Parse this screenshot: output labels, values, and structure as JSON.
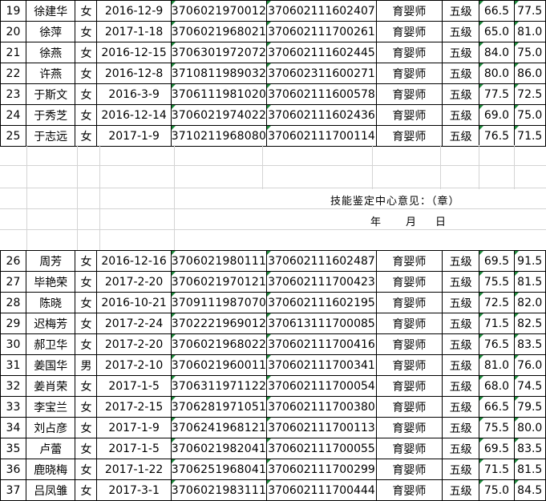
{
  "upper_rows": [
    {
      "idx": "19",
      "name": "徐建华",
      "sex": "女",
      "date": "2016-12-9",
      "cert": "3706021970012",
      "cid": "370602111602407",
      "job": "育婴师",
      "level": "五级",
      "s1": "66.5",
      "s2": "77.5"
    },
    {
      "idx": "20",
      "name": "徐萍",
      "sex": "女",
      "date": "2017-1-18",
      "cert": "3706021968021",
      "cid": "370602111700261",
      "job": "育婴师",
      "level": "五级",
      "s1": "65.0",
      "s2": "81.0"
    },
    {
      "idx": "21",
      "name": "徐燕",
      "sex": "女",
      "date": "2016-12-15",
      "cert": "3706301972072",
      "cid": "370602111602445",
      "job": "育婴师",
      "level": "五级",
      "s1": "84.0",
      "s2": "75.0"
    },
    {
      "idx": "22",
      "name": "许燕",
      "sex": "女",
      "date": "2016-12-8",
      "cert": "3710811989032",
      "cid": "370602311600271",
      "job": "育婴师",
      "level": "五级",
      "s1": "80.0",
      "s2": "86.0"
    },
    {
      "idx": "23",
      "name": "于斯文",
      "sex": "女",
      "date": "2016-3-9",
      "cert": "3706111981020",
      "cid": "370602111600578",
      "job": "育婴师",
      "level": "五级",
      "s1": "77.5",
      "s2": "72.5"
    },
    {
      "idx": "24",
      "name": "于秀芝",
      "sex": "女",
      "date": "2016-12-14",
      "cert": "3706021974022",
      "cid": "370602111602436",
      "job": "育婴师",
      "level": "五级",
      "s1": "69.0",
      "s2": "75.0"
    },
    {
      "idx": "25",
      "name": "于志远",
      "sex": "女",
      "date": "2017-1-9",
      "cert": "3710211968080",
      "cid": "370602111700114",
      "job": "育婴师",
      "level": "五级",
      "s1": "76.5",
      "s2": "71.5"
    }
  ],
  "opinion": {
    "label": "技能鉴定中心意见：（章）",
    "year": "年",
    "month": "月",
    "day": "日"
  },
  "lower_rows": [
    {
      "idx": "26",
      "name": "周芳",
      "sex": "女",
      "date": "2016-12-16",
      "cert": "3706021980111",
      "cid": "370602111602487",
      "job": "育婴师",
      "level": "五级",
      "s1": "69.5",
      "s2": "91.5"
    },
    {
      "idx": "27",
      "name": "毕艳荣",
      "sex": "女",
      "date": "2017-2-20",
      "cert": "3706021970121",
      "cid": "370602111700423",
      "job": "育婴师",
      "level": "五级",
      "s1": "75.5",
      "s2": "81.5"
    },
    {
      "idx": "28",
      "name": "陈晓",
      "sex": "女",
      "date": "2016-10-21",
      "cert": "3709111987070",
      "cid": "370602111602195",
      "job": "育婴师",
      "level": "五级",
      "s1": "72.5",
      "s2": "82.0"
    },
    {
      "idx": "29",
      "name": "迟梅芳",
      "sex": "女",
      "date": "2017-2-24",
      "cert": "3702221969012",
      "cid": "370613111700085",
      "job": "育婴师",
      "level": "五级",
      "s1": "71.5",
      "s2": "82.5"
    },
    {
      "idx": "30",
      "name": "郝卫华",
      "sex": "女",
      "date": "2017-2-20",
      "cert": "3706021968022",
      "cid": "370602111700416",
      "job": "育婴师",
      "level": "五级",
      "s1": "76.5",
      "s2": "83.5"
    },
    {
      "idx": "31",
      "name": "姜国华",
      "sex": "男",
      "date": "2017-2-10",
      "cert": "3706021960011",
      "cid": "370602111700341",
      "job": "育婴师",
      "level": "五级",
      "s1": "81.0",
      "s2": "76.0"
    },
    {
      "idx": "32",
      "name": "姜肖荣",
      "sex": "女",
      "date": "2017-1-5",
      "cert": "3706311971122",
      "cid": "370602111700054",
      "job": "育婴师",
      "level": "五级",
      "s1": "68.0",
      "s2": "74.5"
    },
    {
      "idx": "33",
      "name": "李宝兰",
      "sex": "女",
      "date": "2017-2-15",
      "cert": "3706281971051",
      "cid": "370602111700380",
      "job": "育婴师",
      "level": "五级",
      "s1": "66.5",
      "s2": "79.5"
    },
    {
      "idx": "34",
      "name": "刘占彦",
      "sex": "女",
      "date": "2017-1-9",
      "cert": "3706241968121",
      "cid": "370602111700113",
      "job": "育婴师",
      "level": "五级",
      "s1": "75.5",
      "s2": "80.0"
    },
    {
      "idx": "35",
      "name": "卢蕾",
      "sex": "女",
      "date": "2017-1-5",
      "cert": "3706021982041",
      "cid": "370602111700055",
      "job": "育婴师",
      "level": "五级",
      "s1": "69.5",
      "s2": "83.5"
    },
    {
      "idx": "36",
      "name": "鹿晓梅",
      "sex": "女",
      "date": "2017-1-22",
      "cert": "3706251968041",
      "cid": "370602111700299",
      "job": "育婴师",
      "level": "五级",
      "s1": "71.5",
      "s2": "81.5"
    },
    {
      "idx": "37",
      "name": "吕凤雏",
      "sex": "女",
      "date": "2017-3-1",
      "cert": "3706021983111",
      "cid": "370602111700444",
      "job": "育婴师",
      "level": "五级",
      "s1": "75.0",
      "s2": "84.5"
    }
  ],
  "accent_colors": {
    "cell_marker": "#1e8a3c",
    "gridline": "#d4d4d4"
  }
}
